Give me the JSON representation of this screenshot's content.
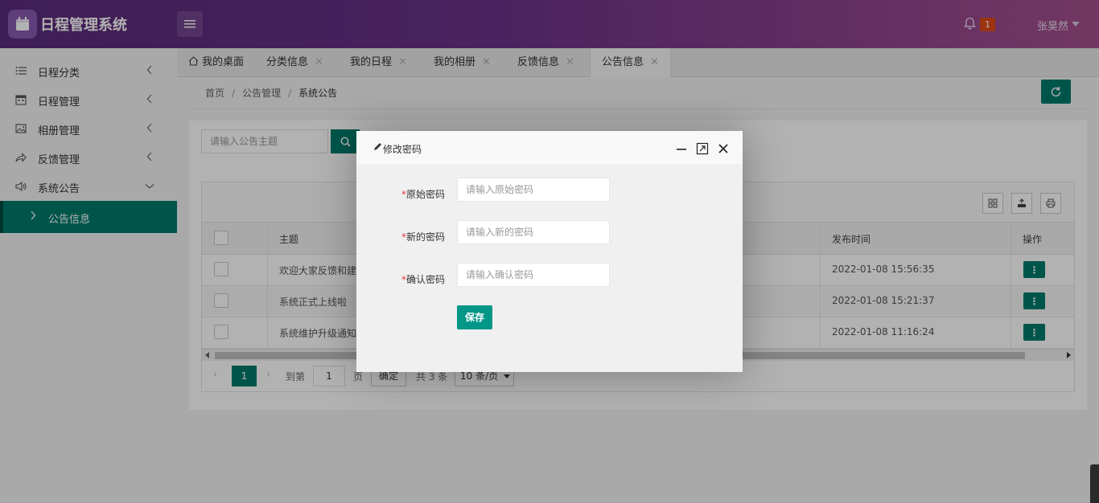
{
  "app": {
    "title": "日程管理系统"
  },
  "header": {
    "notification_count": "1",
    "username": "张昊然"
  },
  "sidebar": {
    "items": [
      {
        "label": "日程分类"
      },
      {
        "label": "日程管理"
      },
      {
        "label": "相册管理"
      },
      {
        "label": "反馈管理"
      },
      {
        "label": "系统公告"
      }
    ],
    "active_sub": "公告信息"
  },
  "tabs": [
    {
      "label": "我的桌面"
    },
    {
      "label": "分类信息"
    },
    {
      "label": "我的日程"
    },
    {
      "label": "我的相册"
    },
    {
      "label": "反馈信息"
    },
    {
      "label": "公告信息"
    }
  ],
  "breadcrumb": {
    "home": "首页",
    "mid": "公告管理",
    "current": "系统公告"
  },
  "search": {
    "placeholder": "请输入公告主题"
  },
  "table": {
    "columns": [
      "主题",
      "发布时间",
      "操作"
    ],
    "rows": [
      {
        "title": "欢迎大家反馈和建",
        "time": "2022-01-08 15:56:35",
        "op": "⋮"
      },
      {
        "title": "系统正式上线啦",
        "time": "2022-01-08 15:21:37",
        "op": "⋮"
      },
      {
        "title": "系统维护升级通知",
        "time": "2022-01-08 11:16:24",
        "op": "⋮"
      }
    ]
  },
  "pager": {
    "current": "1",
    "goto": "到第",
    "input": "1",
    "page": "页",
    "confirm": "确定",
    "total": "共 3 条",
    "size": "10 条/页"
  },
  "modal": {
    "title": "修改密码",
    "fields": [
      {
        "label": "原始密码",
        "placeholder": "请输入原始密码"
      },
      {
        "label": "新的密码",
        "placeholder": "请输入新的密码"
      },
      {
        "label": "确认密码",
        "placeholder": "请输入确认密码"
      }
    ],
    "required_mark": "*",
    "save": "保存"
  },
  "colors": {
    "primary": "#007a6a",
    "header_start": "#5b2a7a",
    "header_end": "#a5508f",
    "badge": "#e04b1a"
  }
}
